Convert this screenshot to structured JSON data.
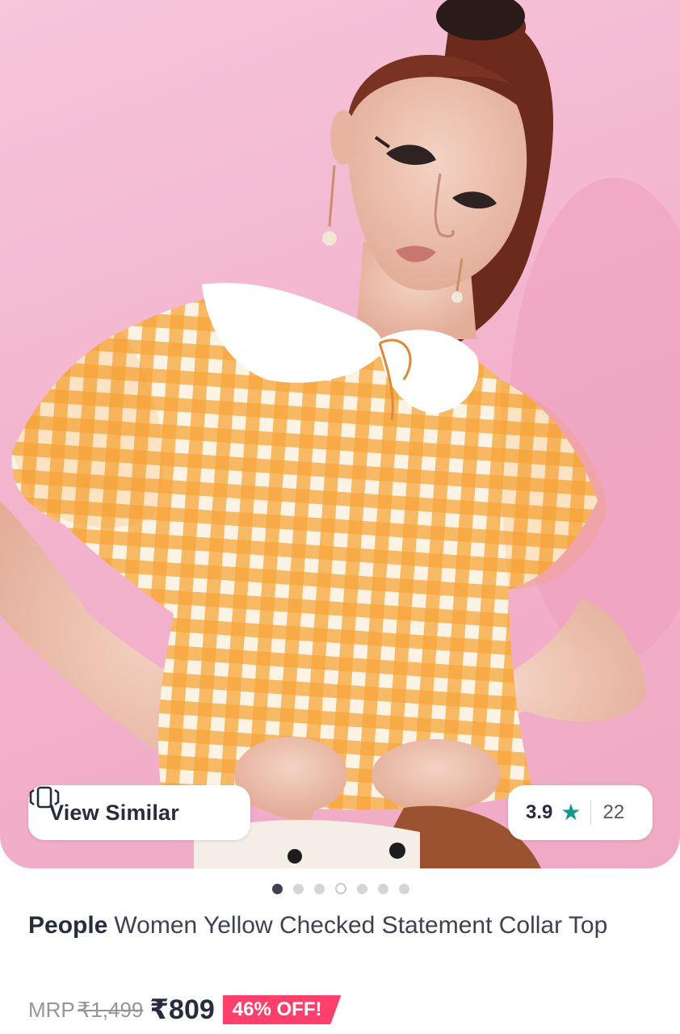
{
  "product_image": {
    "alt": "Model wearing a yellow and white checked top with a white statement collar",
    "colors": {
      "background": "#f3b4cd",
      "top_orange": "#f39a2a",
      "collar": "#ffffff"
    }
  },
  "view_similar": {
    "icon": "view-similar-icon",
    "label": "View Similar"
  },
  "rating": {
    "score": "3.9",
    "star": "★",
    "count": "22",
    "star_color": "#14958f"
  },
  "carousel": {
    "total": 7,
    "active_index": 0
  },
  "product": {
    "brand": "People",
    "name": "Women Yellow Checked Statement Collar Top"
  },
  "pricing": {
    "mrp_label": "MRP",
    "mrp_value": "₹1,499",
    "price": "₹809",
    "discount": "46% OFF!",
    "discount_color": "#ff3f6c"
  }
}
